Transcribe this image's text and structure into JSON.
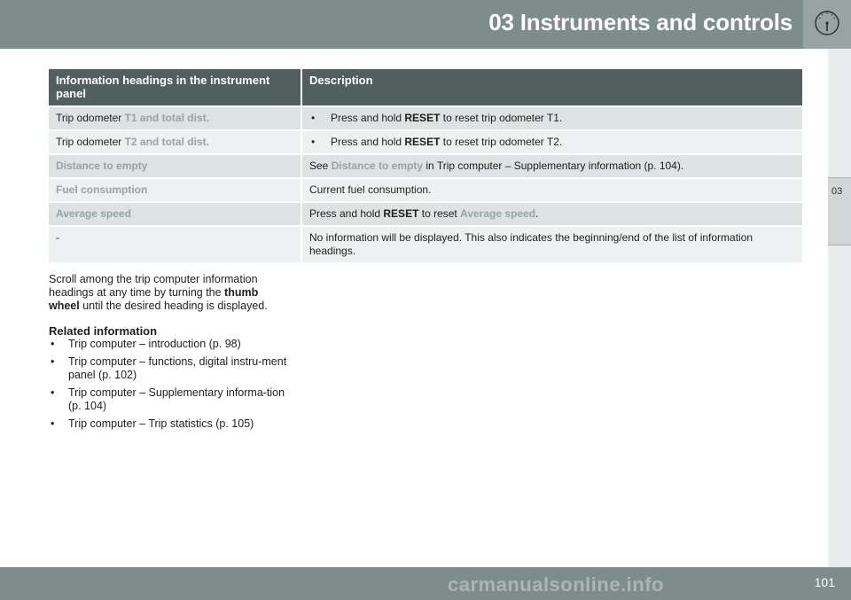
{
  "header": {
    "title": "03 Instruments and controls"
  },
  "sidebar": {
    "chapter": "03"
  },
  "table": {
    "columns": [
      "Information headings in the instrument panel",
      "Description"
    ],
    "rows": [
      {
        "prefix": "Trip odometer ",
        "highlight": "T1 and total dist.",
        "desc": {
          "pre": "Press and hold ",
          "bold": "RESET",
          "post": " to reset trip odometer T1."
        }
      },
      {
        "prefix": "Trip odometer ",
        "highlight": "T2 and total dist.",
        "desc": {
          "pre": "Press and hold ",
          "bold": "RESET",
          "post": " to reset trip odometer T2."
        }
      },
      {
        "highlight": "Distance to empty",
        "desc": {
          "pre": "See ",
          "hl": "Distance to empty",
          "post": " in Trip computer – Supplementary information (p. 104)."
        }
      },
      {
        "highlight": "Fuel consumption",
        "desc": {
          "text": "Current fuel consumption."
        }
      },
      {
        "highlight": "Average speed",
        "desc": {
          "pre": "Press and hold ",
          "bold": "RESET",
          "mid": " to reset ",
          "hl": "Average speed",
          "post": "."
        }
      },
      {
        "prefix": "-",
        "desc": {
          "text": "No information will be displayed. This also indicates the beginning/end of the list of information headings."
        }
      }
    ]
  },
  "body": {
    "pre": "Scroll among the trip computer information headings at any time by turning the ",
    "bold": "thumb wheel",
    "post": " until the desired heading is displayed."
  },
  "related": {
    "heading": "Related information",
    "items": [
      "Trip computer – introduction (p. 98)",
      "Trip computer – functions, digital instru-ment panel (p. 102)",
      "Trip computer – Supplementary informa-tion (p. 104)",
      "Trip computer – Trip statistics (p. 105)"
    ]
  },
  "footer": {
    "page_number": "101",
    "watermark": "carmanualsonline.info"
  },
  "colors": {
    "header": "#7f8c8c",
    "table_header": "#525f5f",
    "highlight": "#98a3a3"
  }
}
